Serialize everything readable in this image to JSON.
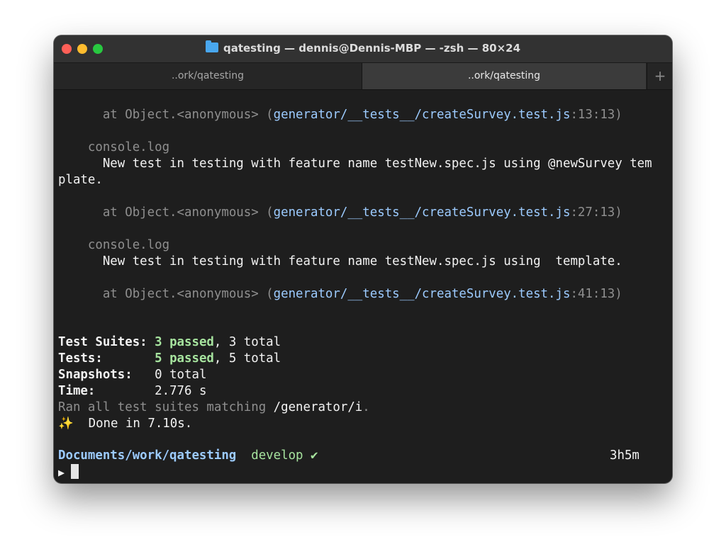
{
  "window": {
    "title": "qatesting — dennis@Dennis-MBP — -zsh — 80×24",
    "title_icon": "folder-icon"
  },
  "tabs": [
    {
      "label": "..ork/qatesting",
      "active": false
    },
    {
      "label": "..ork/qatesting",
      "active": true
    }
  ],
  "tab_add_label": "+",
  "terminal": {
    "trace1": {
      "prefix": "at Object.<anonymous> (",
      "path": "generator/__tests__/createSurvey.test.js",
      "loc": ":13:13)"
    },
    "log1_header": "console.log",
    "log1_line1": "New test in testing with feature name testNew.spec.js using @newSurvey tem",
    "log1_line2": "plate.",
    "trace2": {
      "prefix": "at Object.<anonymous> (",
      "path": "generator/__tests__/createSurvey.test.js",
      "loc": ":27:13)"
    },
    "log2_header": "console.log",
    "log2_line1": "New test in testing with feature name testNew.spec.js using  template.",
    "trace3": {
      "prefix": "at Object.<anonymous> (",
      "path": "generator/__tests__/createSurvey.test.js",
      "loc": ":41:13)"
    },
    "summary": {
      "suites_label": "Test Suites:",
      "suites_passed": "3 passed",
      "suites_total": ", 3 total",
      "tests_label": "Tests:",
      "tests_passed": "5 passed",
      "tests_total": ", 5 total",
      "snapshots_label": "Snapshots:",
      "snapshots_value": "0 total",
      "time_label": "Time:",
      "time_value": "2.776 s",
      "ran_text": "Ran all test suites matching ",
      "ran_pattern": "/generator/i",
      "ran_end": ".",
      "done_icon": "✨",
      "done_text": "Done in 7.10s."
    },
    "prompt": {
      "path": "Documents/work/qatesting",
      "branch": "develop ✔",
      "elapsed": "3h5m",
      "symbol": "▶"
    }
  },
  "colors": {
    "background": "#1e1e1e",
    "path_blue": "#9ccbff",
    "success_green": "#a6e39e",
    "dim_gray": "#8f8f8f"
  }
}
